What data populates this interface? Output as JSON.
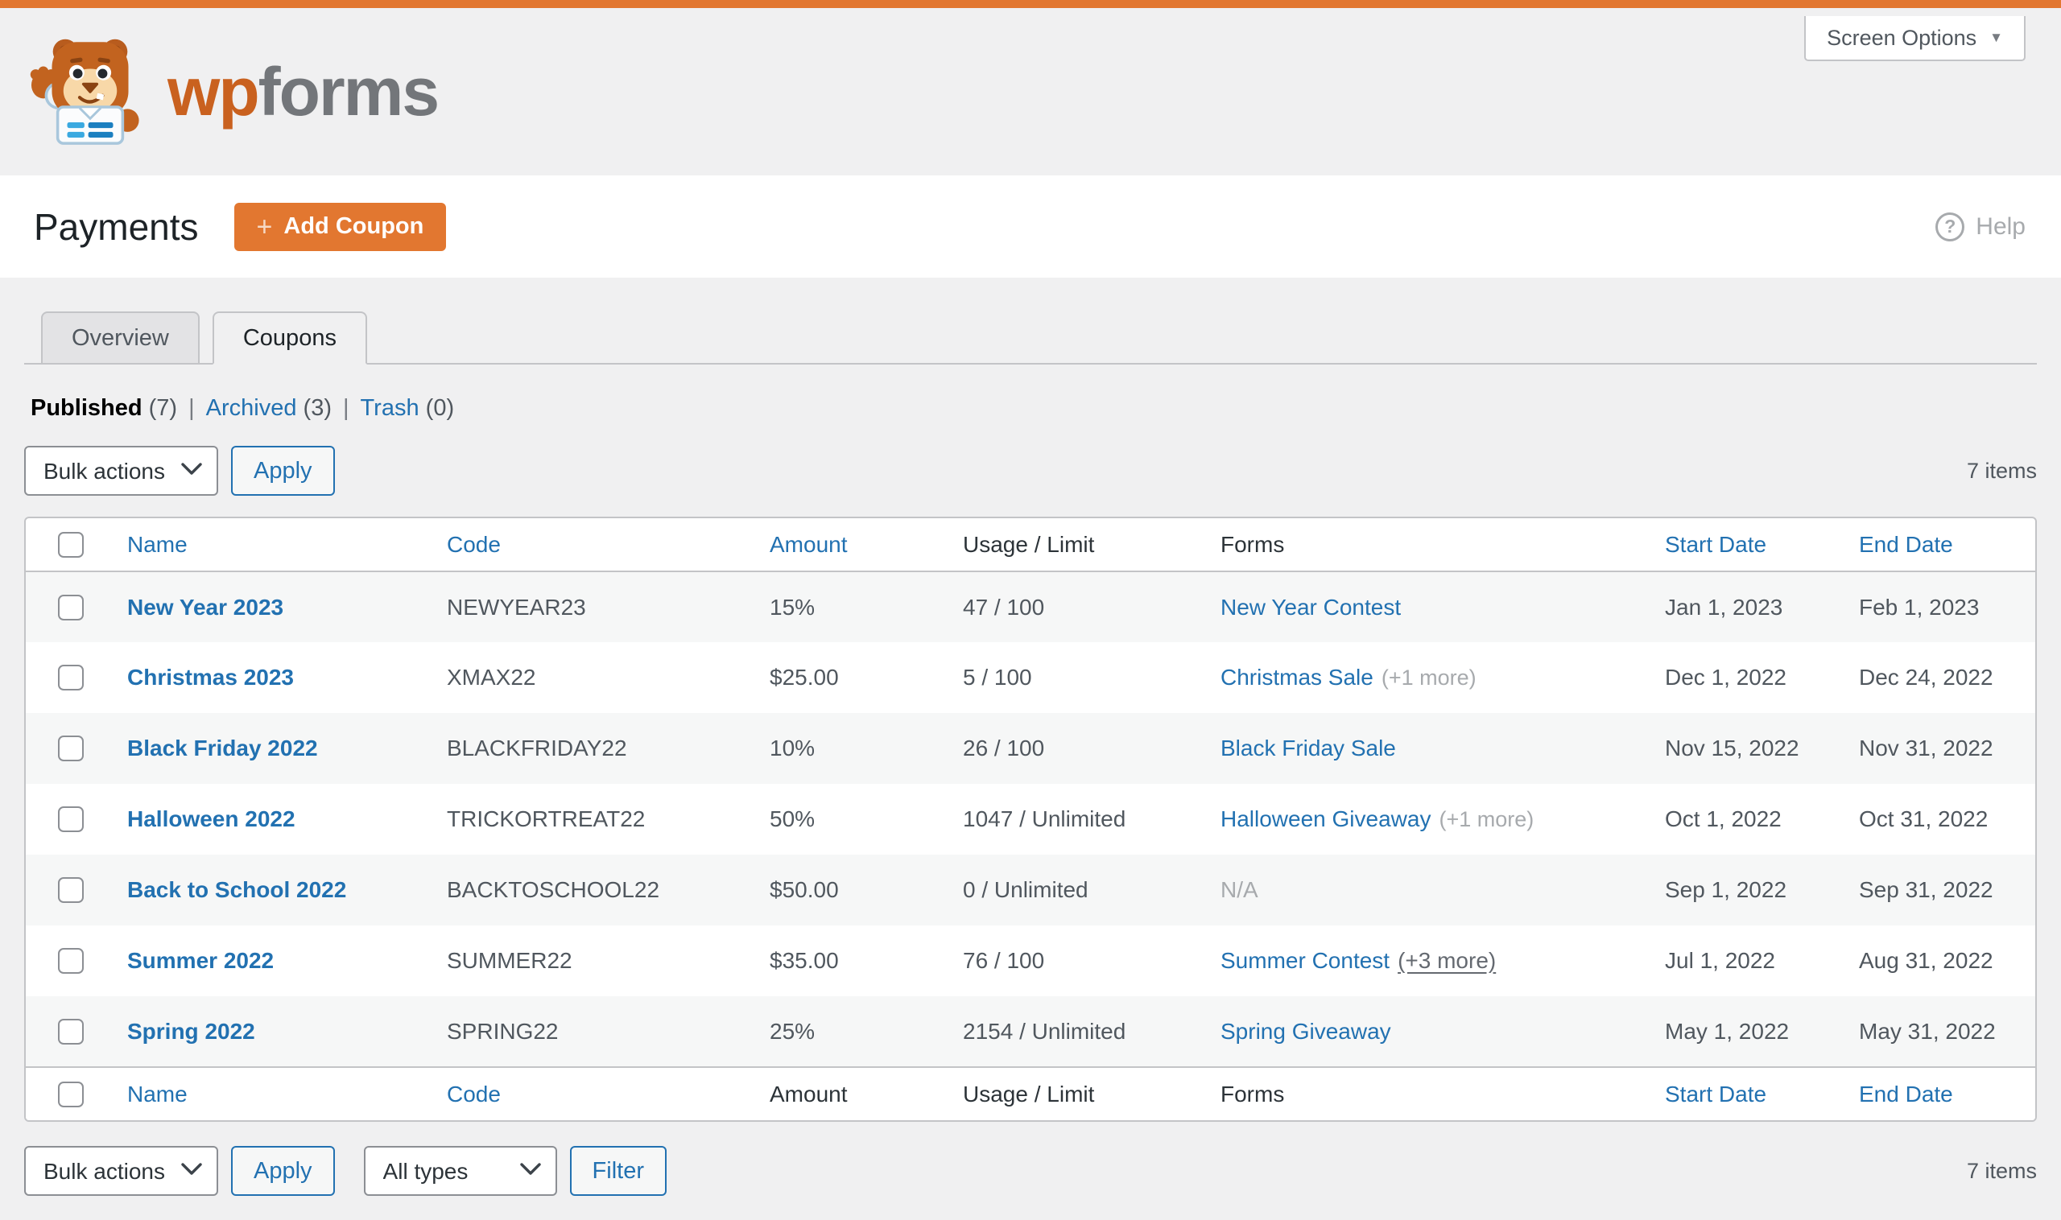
{
  "colors": {
    "brand_orange": "#e27730",
    "link_blue": "#2271b1",
    "page_bg": "#f0f0f1",
    "table_border": "#c3c4c7"
  },
  "icons": {
    "screen_options_caret": "▼",
    "plus": "+",
    "help": "?"
  },
  "brand": {
    "wp": "wp",
    "forms": "forms"
  },
  "masthead": {
    "screen_options": "Screen Options"
  },
  "header": {
    "title": "Payments",
    "add_coupon": "Add Coupon",
    "help": "Help"
  },
  "tabs": {
    "overview": "Overview",
    "coupons": "Coupons"
  },
  "views": {
    "published_label": "Published",
    "published_count": "(7)",
    "archived_label": "Archived",
    "archived_count": "(3)",
    "trash_label": "Trash",
    "trash_count": "(0)",
    "separator": "|"
  },
  "tablenav": {
    "bulk_actions": "Bulk actions",
    "apply": "Apply",
    "all_types": "All types",
    "filter": "Filter",
    "items_count": "7 items"
  },
  "table": {
    "headers": {
      "name": "Name",
      "code": "Code",
      "amount": "Amount",
      "usage": "Usage / Limit",
      "forms": "Forms",
      "start": "Start Date",
      "end": "End Date"
    },
    "rows": [
      {
        "name": "New Year 2023",
        "code": "NEWYEAR23",
        "amount": "15%",
        "usage": "47 / 100",
        "form": "New Year Contest",
        "form_extra": "",
        "start": "Jan 1, 2023",
        "end": "Feb 1, 2023"
      },
      {
        "name": "Christmas 2023",
        "code": "XMAX22",
        "amount": "$25.00",
        "usage": "5 / 100",
        "form": "Christmas Sale",
        "form_extra": "(+1 more)",
        "start": "Dec 1, 2022",
        "end": "Dec 24, 2022"
      },
      {
        "name": "Black Friday 2022",
        "code": "BLACKFRIDAY22",
        "amount": "10%",
        "usage": "26 / 100",
        "form": "Black Friday Sale",
        "form_extra": "",
        "start": "Nov 15, 2022",
        "end": "Nov 31, 2022"
      },
      {
        "name": "Halloween 2022",
        "code": "TRICKORTREAT22",
        "amount": "50%",
        "usage": "1047 / Unlimited",
        "form": "Halloween Giveaway",
        "form_extra": "(+1 more)",
        "start": "Oct 1, 2022",
        "end": "Oct 31, 2022"
      },
      {
        "name": "Back to School 2022",
        "code": "BACKTOSCHOOL22",
        "amount": "$50.00",
        "usage": "0 / Unlimited",
        "form": "N/A",
        "form_extra": "",
        "start": "Sep 1, 2022",
        "end": "Sep 31, 2022"
      },
      {
        "name": "Summer 2022",
        "code": "SUMMER22",
        "amount": "$35.00",
        "usage": "76 / 100",
        "form": "Summer Contest",
        "form_extra": "(+3 more)",
        "start": "Jul 1, 2022",
        "end": "Aug 31, 2022"
      },
      {
        "name": "Spring 2022",
        "code": "SPRING22",
        "amount": "25%",
        "usage": "2154 / Unlimited",
        "form": "Spring Giveaway",
        "form_extra": "",
        "start": "May 1, 2022",
        "end": "May 31, 2022"
      }
    ]
  }
}
